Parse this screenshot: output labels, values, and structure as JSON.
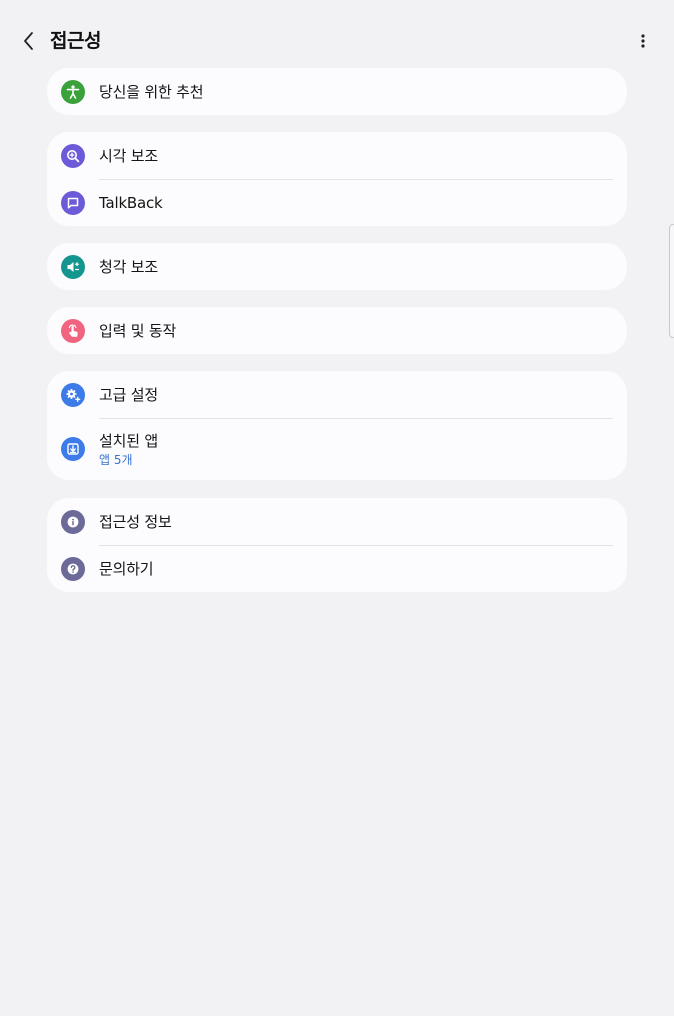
{
  "header": {
    "title": "접근성",
    "back_label": "뒤로",
    "more_label": "옵션 더보기"
  },
  "colors": {
    "background": "#f2f2f4",
    "card": "#fcfcfe",
    "green": "#3aa13b",
    "purple": "#6c5bd9",
    "teal": "#14968f",
    "pink": "#f06480",
    "blue": "#3d7be8",
    "slate": "#6b6a99",
    "link_blue": "#3c73d2"
  },
  "groups": [
    {
      "items": [
        {
          "label": "당신을 위한 추천",
          "icon": "accessibility-person-icon"
        }
      ]
    },
    {
      "items": [
        {
          "label": "시각 보조",
          "icon": "magnifier-icon"
        },
        {
          "label": "TalkBack",
          "icon": "speech-bubble-icon"
        }
      ]
    },
    {
      "items": [
        {
          "label": "청각 보조",
          "icon": "speaker-icon"
        }
      ]
    },
    {
      "items": [
        {
          "label": "입력 및 동작",
          "icon": "touch-hand-icon"
        }
      ]
    },
    {
      "items": [
        {
          "label": "고급 설정",
          "icon": "gear-plus-icon"
        },
        {
          "label": "설치된 앱",
          "sublabel": "앱 5개",
          "icon": "download-icon"
        }
      ]
    },
    {
      "items": [
        {
          "label": "접근성 정보",
          "icon": "info-icon"
        },
        {
          "label": "문의하기",
          "icon": "question-icon"
        }
      ]
    }
  ]
}
